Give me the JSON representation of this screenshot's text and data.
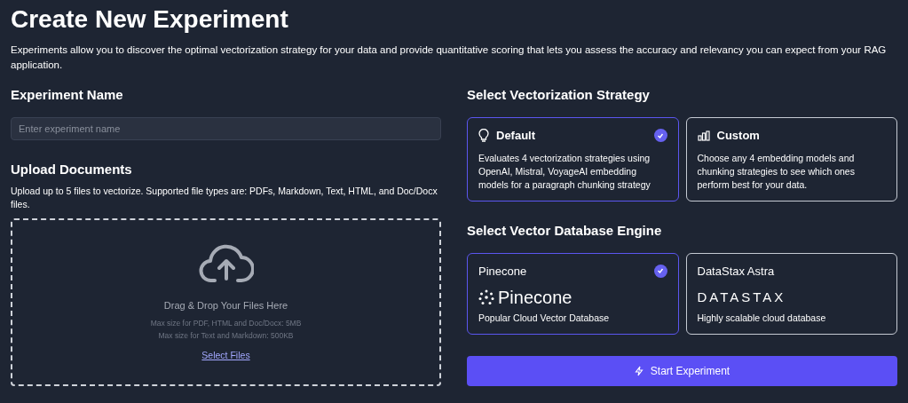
{
  "title": "Create New Experiment",
  "intro": "Experiments allow you to discover the optimal vectorization strategy for your data and provide quantitative scoring that lets you assess the accuracy and relevancy you can expect from your RAG application.",
  "experiment_name": {
    "heading": "Experiment Name",
    "placeholder": "Enter experiment name"
  },
  "upload": {
    "heading": "Upload Documents",
    "description": "Upload up to 5 files to vectorize. Supported file types are: PDFs, Markdown, Text, HTML, and Doc/Docx files.",
    "drop_title": "Drag & Drop Your Files Here",
    "limits": [
      "Max size for PDF, HTML and Doc/Docx: 5MB",
      "Max size for Text and Markdown: 500KB"
    ],
    "link": "Select Files"
  },
  "strategy": {
    "heading": "Select Vectorization Strategy",
    "options": [
      {
        "kind": "bulb",
        "title": "Default",
        "description": "Evaluates 4 vectorization strategies using OpenAI, Mistral, VoyageAI embedding models for a paragraph chunking strategy",
        "selected": true
      },
      {
        "kind": "chart",
        "title": "Custom",
        "description": "Choose any 4 embedding models and chunking strategies to see which ones perform best for your data.",
        "selected": false
      }
    ]
  },
  "database": {
    "heading": "Select Vector Database Engine",
    "options": [
      {
        "kind": "pinecone",
        "title": "Pinecone",
        "logo_text": "Pinecone",
        "description": "Popular Cloud Vector Database",
        "selected": true
      },
      {
        "kind": "datastax",
        "title": "DataStax Astra",
        "logo_text": "DATASTAX",
        "description": "Highly scalable cloud database",
        "selected": false
      }
    ]
  },
  "start_button": "Start Experiment"
}
